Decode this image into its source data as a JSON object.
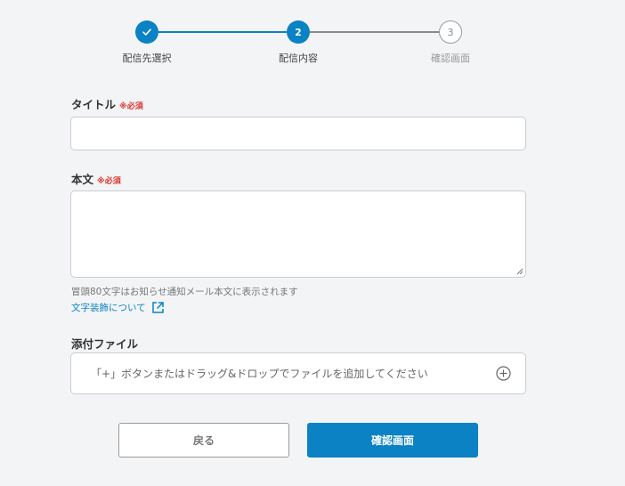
{
  "stepper": {
    "steps": [
      {
        "number": "",
        "label": "配信先選択",
        "state": "completed"
      },
      {
        "number": "2",
        "label": "配信内容",
        "state": "current"
      },
      {
        "number": "3",
        "label": "確認画面",
        "state": "upcoming"
      }
    ],
    "icons": {
      "completed": "check-icon"
    }
  },
  "form": {
    "title": {
      "label": "タイトル",
      "required": "※必須",
      "value": ""
    },
    "body": {
      "label": "本文",
      "required": "※必須",
      "value": "",
      "hint": "冒頭80文字はお知らせ通知メール本文に表示されます",
      "link": "文字装飾について",
      "link_icon": "external-link-icon"
    },
    "attachment": {
      "label": "添付ファイル",
      "placeholder": "「+」ボタンまたはドラッグ&ドロップでファイルを追加してください",
      "icon": "plus-circle-icon"
    }
  },
  "buttons": {
    "back": "戻る",
    "confirm": "確認画面"
  },
  "colors": {
    "accent": "#0a82c4",
    "required": "#d9342b",
    "background": "#f3f4f6"
  }
}
